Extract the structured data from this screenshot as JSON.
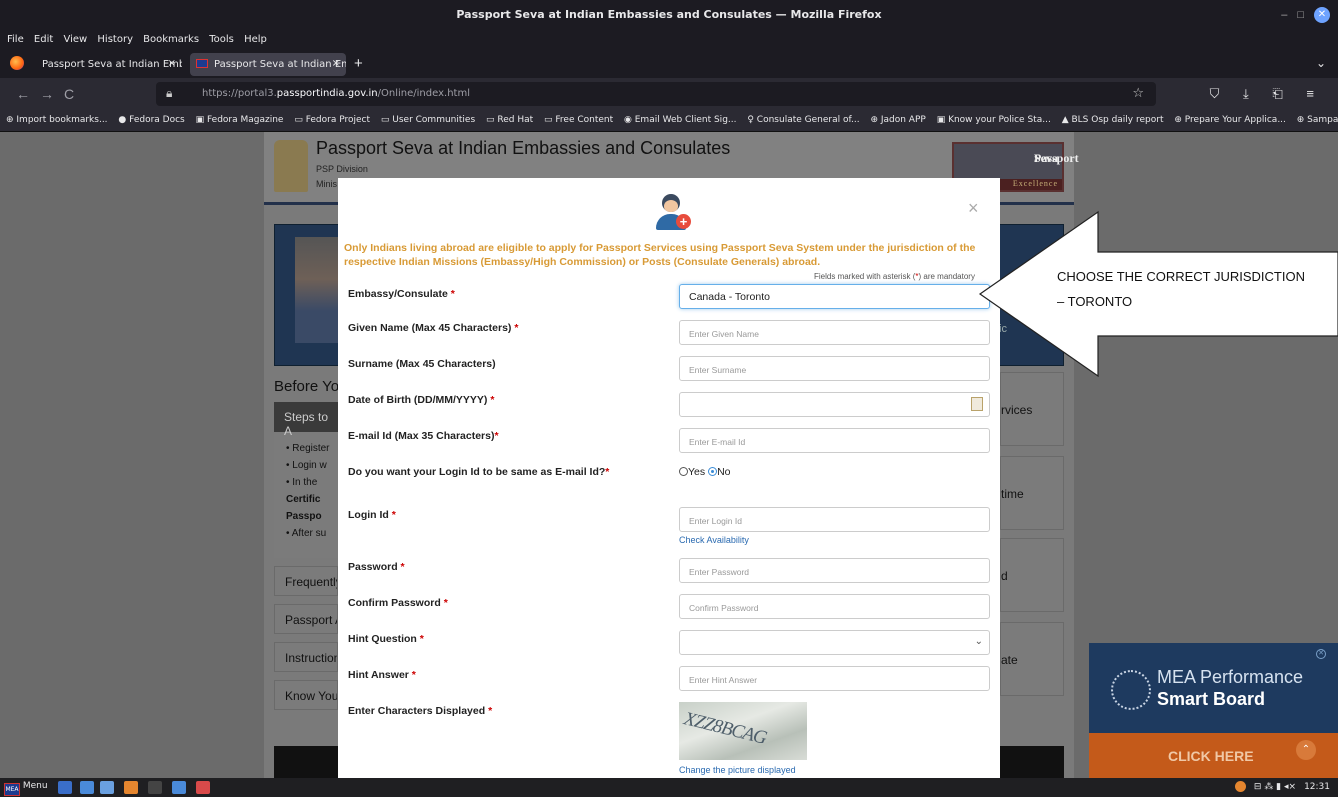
{
  "window": {
    "title": "Passport Seva at Indian Embassies and Consulates — Mozilla Firefox",
    "controls": [
      "–",
      "□",
      "✕"
    ]
  },
  "menubar": [
    "File",
    "Edit",
    "View",
    "History",
    "Bookmarks",
    "Tools",
    "Help"
  ],
  "tabs": [
    {
      "label": "Passport Seva at Indian Embassie",
      "close": "×"
    },
    {
      "label": "Passport Seva at Indian Emba",
      "close": "×"
    }
  ],
  "new_tab": "+",
  "tabs_menu": "⌄",
  "navbar": {
    "back": "←",
    "forward": "→",
    "reload": "C",
    "url_prefix": "https://portal3.",
    "url_domain": "passportindia.gov.in",
    "url_path": "/Online/index.html",
    "right_icons": "⛉ ⤓ ⎗ ≡"
  },
  "bookmarks": [
    "⊕ Import bookmarks...",
    "● Fedora Docs",
    "▣ Fedora Magazine",
    "▭ Fedora Project",
    "▭ User Communities",
    "▭ Red Hat",
    "▭ Free Content",
    "◉ Email Web Client Sig...",
    "♀ Consulate General of...",
    "⊕ Jadon APP",
    "▣ Know your Police Sta...",
    "▲ BLS Osp daily report",
    "⊕ Prepare Your Applica...",
    "⊕ Sampark APP"
  ],
  "site": {
    "title": "Passport Seva at Indian Embassies and Consulates",
    "sub1": "PSP Division",
    "sub2": "Minis",
    "logo_line1": "Passport",
    "logo_line2": "Seva",
    "logo_excellence": "Excellence",
    "hero_right": "ic",
    "before_you": "Before You",
    "steps_head": "Steps to A",
    "steps": [
      "• Register",
      "• Login w",
      "• In  the",
      "Certific",
      "Passpo",
      "• After su"
    ],
    "faq": [
      "Frequently",
      "Passport A",
      "Instruction",
      "Know Your"
    ],
    "right_cards": [
      "rvices",
      "time",
      "d",
      "ate"
    ]
  },
  "modal": {
    "notice": "Only Indians living abroad are eligible to apply for Passport Services using Passport Seva System under the jurisdiction of the respective Indian Missions (Embassy/High Commission) or Posts (Consulate Generals) abroad.",
    "mandatory_pre": "Fields marked with asterisk (",
    "mandatory_ast": "*",
    "mandatory_post": ") are mandatory",
    "close": "×",
    "fields": {
      "embassy": {
        "label": "Embassy/Consulate ",
        "value": "Canada - Toronto"
      },
      "given_name": {
        "label": "Given Name (Max 45 Characters) ",
        "placeholder": "Enter Given Name"
      },
      "surname": {
        "label": "Surname (Max 45 Characters)",
        "placeholder": "Enter Surname"
      },
      "dob": {
        "label": "Date of Birth (DD/MM/YYYY) ",
        "placeholder": ""
      },
      "email": {
        "label": "E-mail Id (Max 35 Characters)",
        "placeholder": "Enter E-mail Id"
      },
      "same_login": {
        "label": "Do you want your Login Id to be same as E-mail Id?",
        "yes": "Yes",
        "no": "No",
        "selected": "No"
      },
      "login_id": {
        "label": "Login Id ",
        "placeholder": "Enter Login Id",
        "check": "Check Availability"
      },
      "password": {
        "label": "Password ",
        "placeholder": "Enter Password"
      },
      "confirm_password": {
        "label": "Confirm Password ",
        "placeholder": "Confirm Password"
      },
      "hint_question": {
        "label": "Hint Question ",
        "value": ""
      },
      "hint_answer": {
        "label": "Hint Answer ",
        "placeholder": "Enter Hint Answer"
      },
      "captcha": {
        "label": "Enter Characters Displayed",
        "text": "XZZ8BCAG",
        "change": "Change the picture displayed"
      }
    },
    "req_mark": "*"
  },
  "callout": {
    "line1": "CHOOSE THE CORRECT JURISDICTION",
    "line2": "– TORONTO"
  },
  "mea_widget": {
    "close": "✕",
    "line1": "MEA Performance",
    "line2": "Smart Board",
    "cta": "CLICK HERE",
    "up": "⌃"
  },
  "taskbar": {
    "menu": "Menu",
    "menu_logo": "MEA",
    "clock": "12:31",
    "tray_icons": "⊟ ⁂ ▮ ◂×"
  },
  "colors": {
    "notice": "#d89a35",
    "required": "#cc0000",
    "link": "#2a6ab0",
    "mea_bg": "#1e3a5f",
    "mea_cta": "#c45a1a"
  }
}
